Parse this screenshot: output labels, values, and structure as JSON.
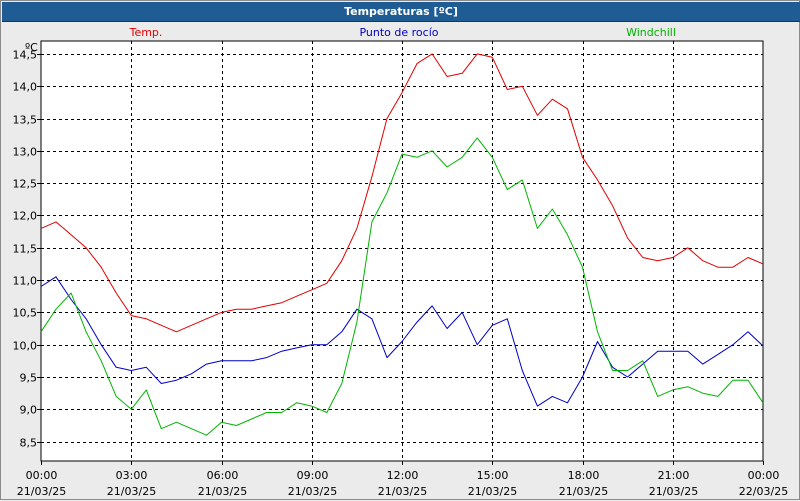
{
  "window": {
    "title": "Temperaturas [ºC]"
  },
  "chart_data": {
    "type": "line",
    "title": "Temperaturas [ºC]",
    "yunit": "ºC",
    "ylim": [
      8.2,
      14.7
    ],
    "yticks": [
      "8,5",
      "9,0",
      "9,5",
      "10,0",
      "10,5",
      "11,0",
      "11,5",
      "12,0",
      "12,5",
      "13,0",
      "13,5",
      "14,0",
      "14,5"
    ],
    "xlim": [
      0,
      24
    ],
    "xticks": [
      {
        "time": "00:00",
        "date": "21/03/25"
      },
      {
        "time": "03:00",
        "date": "21/03/25"
      },
      {
        "time": "06:00",
        "date": "21/03/25"
      },
      {
        "time": "09:00",
        "date": "21/03/25"
      },
      {
        "time": "12:00",
        "date": "21/03/25"
      },
      {
        "time": "15:00",
        "date": "21/03/25"
      },
      {
        "time": "18:00",
        "date": "21/03/25"
      },
      {
        "time": "21:00",
        "date": "21/03/25"
      },
      {
        "time": "00:00",
        "date": "22/03/25"
      }
    ],
    "grid": true,
    "legend_position": "top",
    "series": [
      {
        "name": "Temp.",
        "color": "#e00000",
        "x": [
          0,
          0.5,
          1.0,
          1.5,
          2.0,
          2.5,
          3.0,
          3.5,
          4.0,
          4.5,
          5.0,
          5.5,
          6.0,
          6.5,
          7.0,
          7.5,
          8.0,
          8.5,
          9.0,
          9.5,
          10.0,
          10.5,
          11.0,
          11.5,
          12.0,
          12.5,
          13.0,
          13.5,
          14.0,
          14.5,
          15.0,
          15.5,
          16.0,
          16.5,
          17.0,
          17.5,
          18.0,
          18.5,
          19.0,
          19.5,
          20.0,
          20.5,
          21.0,
          21.5,
          22.0,
          22.5,
          23.0,
          23.5,
          24.0
        ],
        "y": [
          11.8,
          11.9,
          11.7,
          11.5,
          11.2,
          10.8,
          10.45,
          10.4,
          10.3,
          10.2,
          10.3,
          10.4,
          10.5,
          10.55,
          10.55,
          10.6,
          10.65,
          10.75,
          10.85,
          10.95,
          11.3,
          11.8,
          12.6,
          13.5,
          13.9,
          14.35,
          14.5,
          14.15,
          14.2,
          14.5,
          14.45,
          13.95,
          14.0,
          13.55,
          13.8,
          13.65,
          12.9,
          12.55,
          12.15,
          11.65,
          11.35,
          11.3,
          11.35,
          11.5,
          11.3,
          11.2,
          11.2,
          11.35,
          11.25
        ]
      },
      {
        "name": "Punto de rocío",
        "color": "#0000c8",
        "x": [
          0,
          0.5,
          1.0,
          1.5,
          2.0,
          2.5,
          3.0,
          3.5,
          4.0,
          4.5,
          5.0,
          5.5,
          6.0,
          6.5,
          7.0,
          7.5,
          8.0,
          8.5,
          9.0,
          9.5,
          10.0,
          10.5,
          11.0,
          11.5,
          12.0,
          12.5,
          13.0,
          13.5,
          14.0,
          14.5,
          15.0,
          15.5,
          16.0,
          16.5,
          17.0,
          17.5,
          18.0,
          18.5,
          19.0,
          19.5,
          20.0,
          20.5,
          21.0,
          21.5,
          22.0,
          22.5,
          23.0,
          23.5,
          24.0
        ],
        "y": [
          10.9,
          11.05,
          10.7,
          10.4,
          10.0,
          9.65,
          9.6,
          9.65,
          9.4,
          9.45,
          9.55,
          9.7,
          9.75,
          9.75,
          9.75,
          9.8,
          9.9,
          9.95,
          10.0,
          10.0,
          10.2,
          10.55,
          10.4,
          9.8,
          10.05,
          10.35,
          10.6,
          10.25,
          10.5,
          10.0,
          10.3,
          10.4,
          9.6,
          9.05,
          9.2,
          9.1,
          9.5,
          10.05,
          9.65,
          9.5,
          9.7,
          9.9,
          9.9,
          9.9,
          9.7,
          9.85,
          10.0,
          10.2,
          9.98
        ]
      },
      {
        "name": "Windchill",
        "color": "#00b400",
        "x": [
          0,
          0.5,
          1.0,
          1.5,
          2.0,
          2.5,
          3.0,
          3.5,
          4.0,
          4.5,
          5.0,
          5.5,
          6.0,
          6.5,
          7.0,
          7.5,
          8.0,
          8.5,
          9.0,
          9.5,
          10.0,
          10.5,
          11.0,
          11.5,
          12.0,
          12.5,
          13.0,
          13.5,
          14.0,
          14.5,
          15.0,
          15.5,
          16.0,
          16.5,
          17.0,
          17.5,
          18.0,
          18.5,
          19.0,
          19.5,
          20.0,
          20.5,
          21.0,
          21.5,
          22.0,
          22.5,
          23.0,
          23.5,
          24.0
        ],
        "y": [
          10.2,
          10.55,
          10.8,
          10.2,
          9.75,
          9.2,
          9.0,
          9.3,
          8.7,
          8.8,
          8.7,
          8.6,
          8.8,
          8.75,
          8.85,
          8.95,
          8.95,
          9.1,
          9.05,
          8.95,
          9.4,
          10.35,
          11.9,
          12.35,
          12.95,
          12.9,
          13.0,
          12.75,
          12.9,
          13.2,
          12.9,
          12.4,
          12.55,
          11.8,
          12.1,
          11.7,
          11.2,
          10.2,
          9.6,
          9.6,
          9.75,
          9.2,
          9.3,
          9.35,
          9.25,
          9.2,
          9.45,
          9.45,
          9.1
        ]
      }
    ]
  }
}
